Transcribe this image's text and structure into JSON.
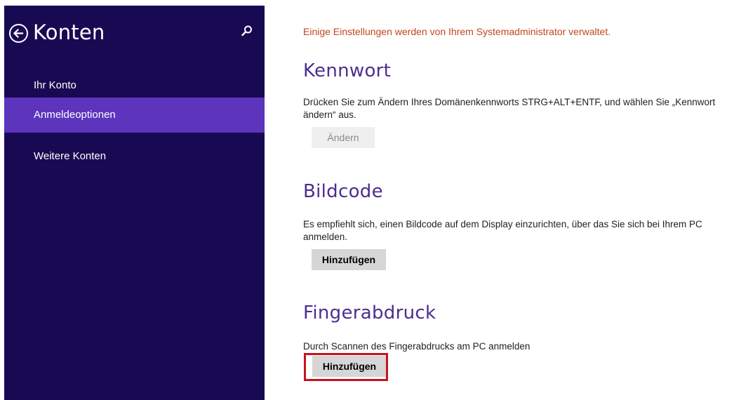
{
  "sidebar": {
    "title": "Konten",
    "back_icon": "back-arrow-circle-icon",
    "search_icon": "search-icon",
    "items": [
      {
        "label": "Ihr Konto",
        "active": false
      },
      {
        "label": "Anmeldeoptionen",
        "active": true
      },
      {
        "label": "Weitere Konten",
        "active": false
      }
    ]
  },
  "main": {
    "notice": "Einige Einstellungen werden von Ihrem Systemadministrator verwaltet.",
    "sections": [
      {
        "title": "Kennwort",
        "description": "Drücken Sie zum Ändern Ihres Domänenkennworts STRG+ALT+ENTF, und wählen Sie „Kennwort ändern“ aus.",
        "button": "Ändern",
        "button_enabled": false
      },
      {
        "title": "Bildcode",
        "description": "Es empfiehlt sich, einen Bildcode auf dem Display einzurichten, über das Sie sich bei Ihrem PC anmelden.",
        "button": "Hinzufügen",
        "button_enabled": true
      },
      {
        "title": "Fingerabdruck",
        "description": "Durch Scannen des Fingerabdrucks am PC anmelden",
        "button": "Hinzufügen",
        "button_enabled": true,
        "highlighted": true
      }
    ]
  },
  "colors": {
    "sidebar_bg": "#180a52",
    "active_item_bg": "#5d34bc",
    "section_title": "#4b2e91",
    "notice_text": "#c2461d",
    "highlight_border": "#c8121b"
  }
}
